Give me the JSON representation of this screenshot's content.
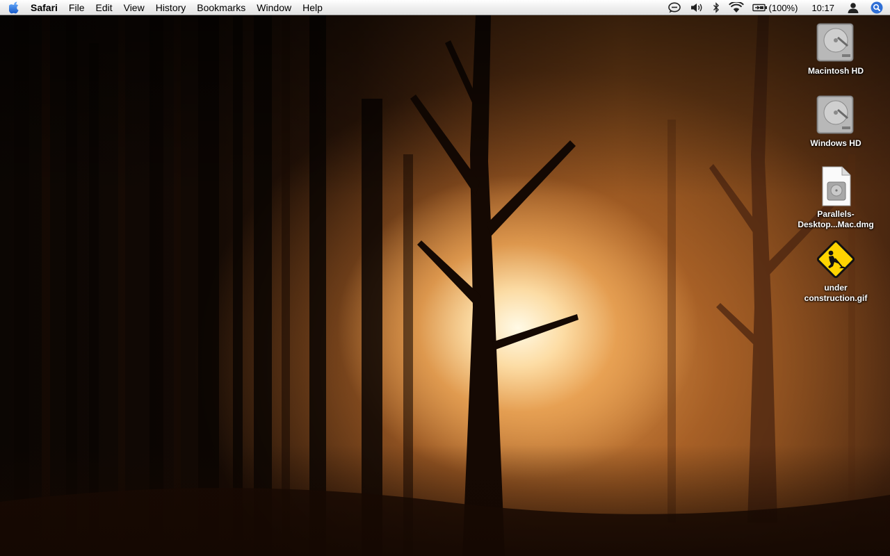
{
  "menubar": {
    "apple_icon": "apple-icon",
    "app_name": "Safari",
    "menus": [
      "File",
      "Edit",
      "View",
      "History",
      "Bookmarks",
      "Window",
      "Help"
    ],
    "status": {
      "battery_percent": "(100%)",
      "clock": "10:17",
      "icons": [
        "ichat-status-icon",
        "volume-icon",
        "bluetooth-icon",
        "wifi-icon",
        "battery-icon",
        "user-icon",
        "spotlight-icon"
      ]
    }
  },
  "desktop": {
    "icons": [
      {
        "label": "Macintosh HD",
        "icon": "hard-drive-icon"
      },
      {
        "label": "Windows HD",
        "icon": "hard-drive-icon"
      },
      {
        "label": "Parallels-Desktop...Mac.dmg",
        "line1": "Parallels-",
        "line2": "Desktop...Mac.dmg",
        "icon": "disk-image-icon"
      },
      {
        "label": "under construction.gif",
        "line1": "under",
        "line2": "construction.gif",
        "icon": "construction-sign-icon"
      }
    ]
  },
  "colors": {
    "menubar_bg": "#f1f1f1",
    "spotlight_blue": "#2f6fd6",
    "construction_yellow": "#ffd400"
  }
}
